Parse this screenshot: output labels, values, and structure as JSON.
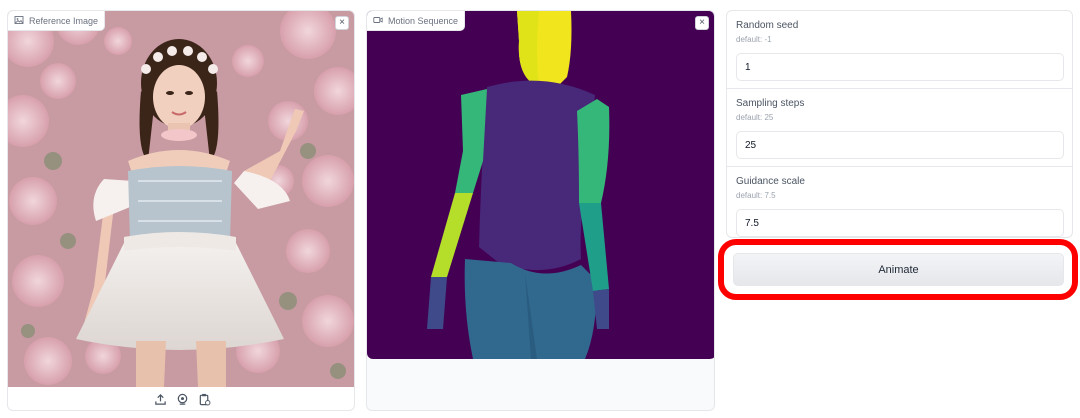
{
  "reference_panel": {
    "label": "Reference Image",
    "label_icon": "image-icon",
    "close_label": "×",
    "toolbar": [
      "upload-icon",
      "webcam-icon",
      "clipboard-icon"
    ]
  },
  "motion_panel": {
    "label": "Motion Sequence",
    "label_icon": "video-icon",
    "close_label": "×"
  },
  "settings": {
    "seed": {
      "label": "Random seed",
      "info": "default: -1",
      "value": "1"
    },
    "steps": {
      "label": "Sampling steps",
      "info": "default: 25",
      "value": "25"
    },
    "guidance": {
      "label": "Guidance scale",
      "info": "default: 7.5",
      "value": "7.5"
    }
  },
  "animate": {
    "label": "Animate"
  },
  "colors": {
    "highlight": "#ff0000",
    "motion_background": "#440154",
    "pose_head": "#f1e51d",
    "pose_torso": "#482878",
    "pose_legs": "#31688e",
    "pose_arm_green": "#35b779",
    "pose_arm_lime": "#b5de2b",
    "pose_hand": "#3e4a89"
  }
}
